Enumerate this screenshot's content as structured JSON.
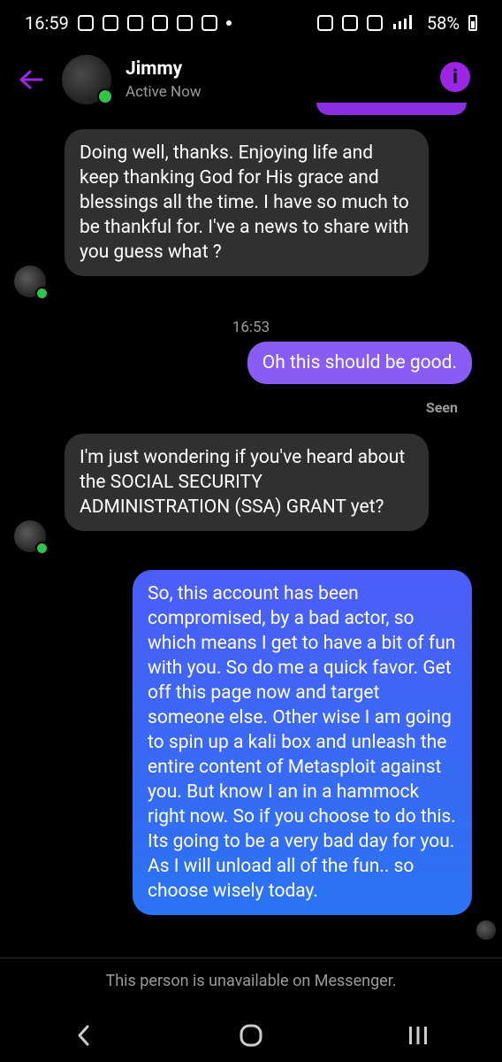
{
  "status_bar": {
    "time": "16:59",
    "battery": "58%",
    "icons": [
      "messenger-icon",
      "home-icon",
      "reddit-icon",
      "notification-icon",
      "outlook-icon",
      "linkedin-icon",
      "dot-icon",
      "key-icon",
      "alarm-icon",
      "mute-icon",
      "signal-icon",
      "battery-icon"
    ]
  },
  "header": {
    "name": "Jimmy",
    "status": "Active Now",
    "info_icon": "i"
  },
  "messages": [
    {
      "direction": "in",
      "text": "Doing well, thanks. Enjoying life and keep thanking God for His grace and blessings all the time. I have so much to be thankful for. I've a news to share with you guess what ?"
    },
    {
      "direction": "out",
      "text": "Oh this should be good."
    },
    {
      "direction": "in",
      "text": "I'm just wondering if you've heard about the SOCIAL SECURITY ADMINISTRATION (SSA) GRANT yet?"
    },
    {
      "direction": "out",
      "text": "So, this account has been compromised, by a bad actor, so which means I get to have a bit of fun with you. So do me a quick favor. Get off this page now and target someone else. Other wise I am going to spin up a kali box and unleash the entire content of Metasploit against you. But know I an in a hammock right now. So if you choose to do this. Its going to be a very bad day for you. As I will unload all of the fun.. so choose wisely today."
    }
  ],
  "timestamp": "16:53",
  "seen_label": "Seen",
  "footer_note": "This person is unavailable on Messenger.",
  "colors": {
    "accent": "#9b26e6",
    "bubble_purple": "#8a5cf6",
    "bubble_blue": "#2f6cf4",
    "bubble_gray": "#303030",
    "online": "#31c34a"
  }
}
